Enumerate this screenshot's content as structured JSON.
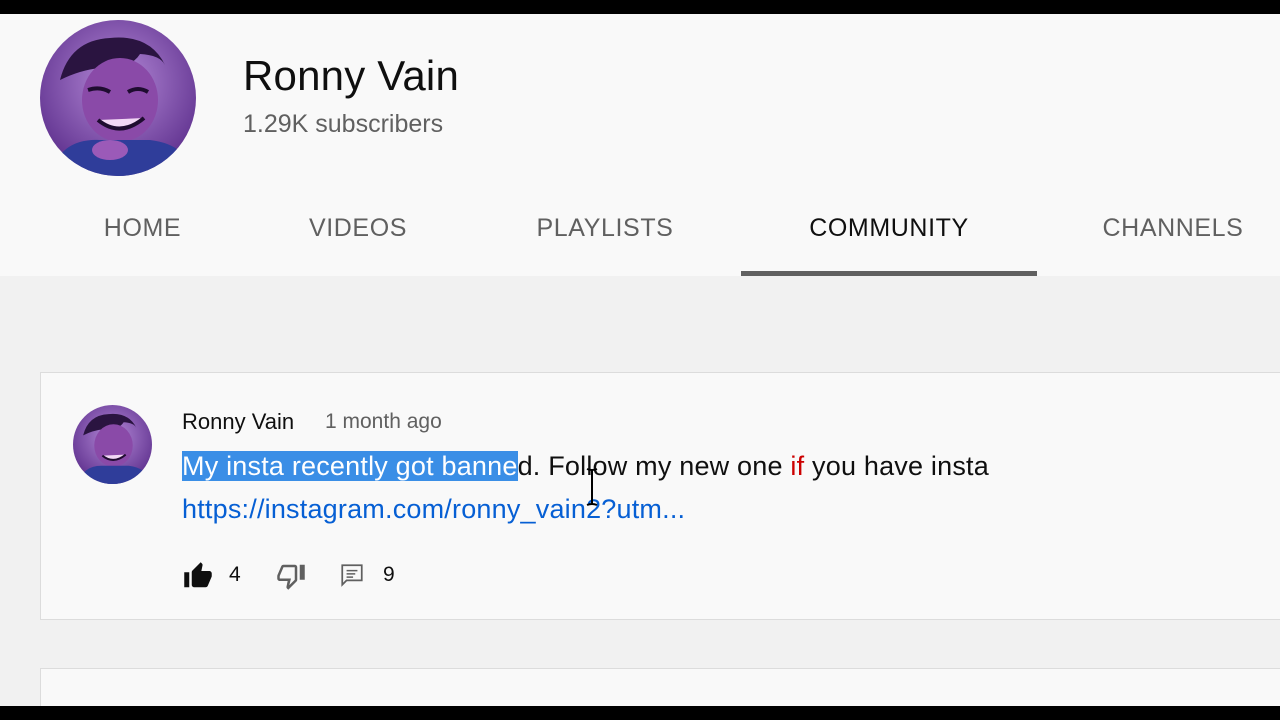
{
  "channel": {
    "name": "Ronny Vain",
    "subscribers": "1.29K subscribers",
    "avatar_icon": "channel-avatar-cartoon-portrait"
  },
  "tabs": [
    {
      "label": "HOME",
      "active": false
    },
    {
      "label": "VIDEOS",
      "active": false
    },
    {
      "label": "PLAYLISTS",
      "active": false
    },
    {
      "label": "COMMUNITY",
      "active": true
    },
    {
      "label": "CHANNELS",
      "active": false
    }
  ],
  "post": {
    "author": "Ronny Vain",
    "time": "1 month ago",
    "text_selected": "My insta recently got banne",
    "text_rest_1": "d. Follow my new one ",
    "text_highlight": "if",
    "text_rest_2": " you have insta",
    "link": "https://instagram.com/ronny_vain2?utm...",
    "likes": "4",
    "comments": "9",
    "icons": {
      "like": "thumbs-up-icon",
      "dislike": "thumbs-down-icon",
      "comment": "comment-icon"
    }
  },
  "colors": {
    "accent_link": "#065fd4",
    "selection": "#3a8ee6",
    "active_tab_underline": "#606060",
    "highlight_word": "#cc0000"
  }
}
